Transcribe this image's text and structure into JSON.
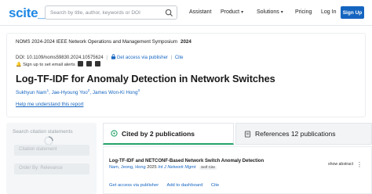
{
  "header": {
    "logo": "scite_",
    "search_placeholder": "Search by title, author, keywords or DOI",
    "nav": {
      "assistant": "Assistant",
      "product": "Product",
      "solutions": "Solutions",
      "pricing": "Pricing",
      "login": "Log In",
      "signup": "Sign Up"
    }
  },
  "paper": {
    "venue": "NOMS 2024-2024 IEEE Network Operations and Management Symposium",
    "year": "2024",
    "doi": "DOI: 10.1109/noms59830.2024.10575624",
    "access_link": "Get access via publisher",
    "cite_link": "Cite",
    "alert_text": "Sign up to set email alerts",
    "title": "Log-TF-IDF for Anomaly Detection in Network Switches",
    "authors": [
      {
        "name": "Sukhyun Nam",
        "sup": "1"
      },
      {
        "name": "Jae-Hyoung Yoo",
        "sup": "2"
      },
      {
        "name": "James Won-Ki Hong",
        "sup": "3"
      }
    ],
    "help_link": "Help me understand this report"
  },
  "filters": {
    "search_label": "Search citation statements",
    "search_input": "Citation statement",
    "order_by": "Order By: Relevance"
  },
  "tabs": {
    "cited_by": "Cited by 2 publications",
    "references": "References 12 publications"
  },
  "citations": [
    {
      "title": "Log-TF-IDF and NETCONF-Based Network Switch Anomaly Detection",
      "authors": "Nam, Jeong, Hong",
      "year": "2025",
      "journal": "Int J Network Mgmt",
      "badge": "Self Cite",
      "show_abstract": "show abstract",
      "actions": [
        "Get access via publisher",
        "Add to dashboard",
        "Cite"
      ]
    }
  ],
  "colors": {
    "brand": "#1e88e5",
    "signup": "#1565c0",
    "link": "#1565c0",
    "active_tab": "#26a269"
  },
  "icons": [
    "search-icon",
    "lock-icon",
    "twitter-icon",
    "facebook-icon",
    "linkedin-icon",
    "chevron-down-icon",
    "spinner-icon",
    "chat-icon",
    "document-icon",
    "more-icon"
  ]
}
